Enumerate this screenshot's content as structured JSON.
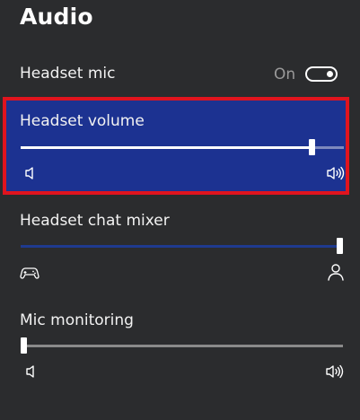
{
  "title": "Audio",
  "headset_mic": {
    "label": "Headset mic",
    "state": "On"
  },
  "headset_volume": {
    "label": "Headset volume",
    "level": 0.9
  },
  "chat_mixer": {
    "label": "Headset chat mixer",
    "level": 1.0
  },
  "mic_monitoring": {
    "label": "Mic monitoring",
    "level": 0.0
  },
  "icons": {
    "volume_low": "speaker-low-icon",
    "volume_high": "speaker-high-icon",
    "game": "gamepad-icon",
    "chat": "person-icon"
  },
  "colors": {
    "background": "#2b2c2e",
    "highlight": "#1c3291",
    "highlight_border": "#e0141e",
    "mixer_track": "#1f3a8f"
  }
}
